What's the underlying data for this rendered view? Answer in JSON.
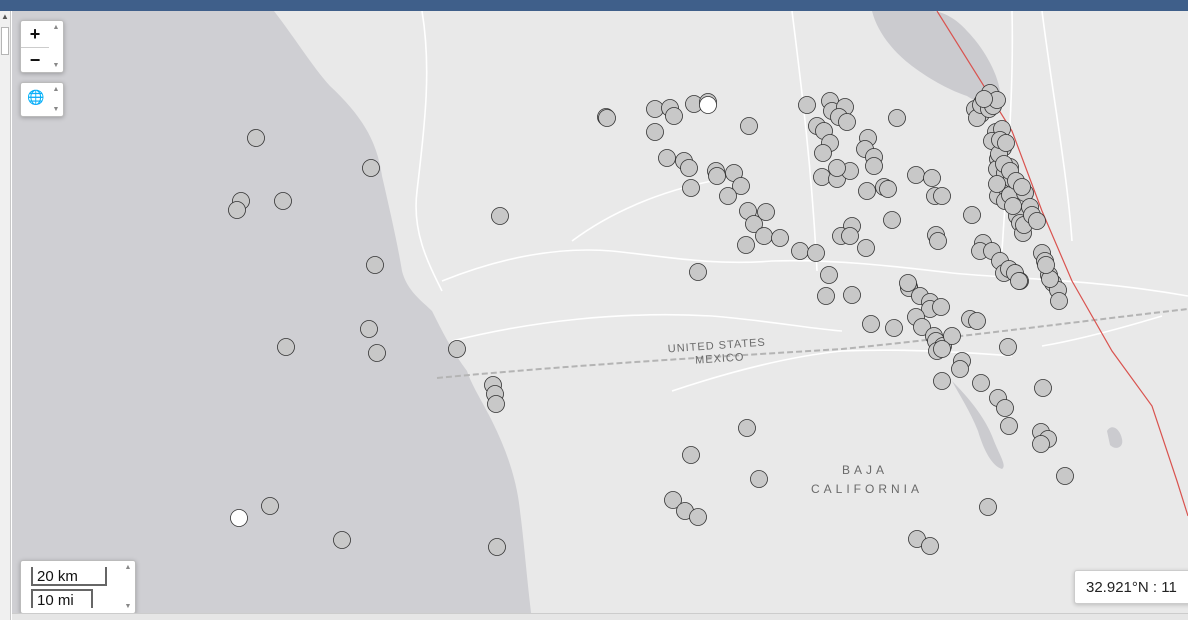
{
  "map": {
    "zoom_in_label": "+",
    "zoom_out_label": "−",
    "layers_icon": "globe-icon",
    "border_label_us": "UNITED STATES",
    "border_label_mx": "MEXICO",
    "region_label_line1": "BAJA",
    "region_label_line2": "CALIFORNIA",
    "scale_km": "20 km",
    "scale_mi": "10 mi",
    "coordinate_readout": "32.921°N : 11"
  },
  "colors": {
    "ocean": "#cfcfd3",
    "land": "#e9e9e9",
    "lake": "#cbcbcf",
    "road": "#ffffff",
    "border": "#b4b4b4",
    "fault": "#d9534f",
    "marker_fill": "#c8c8c8",
    "marker_highlight": "#ffffff",
    "marker_stroke": "#333333"
  },
  "markers": {
    "highlighted_count": 2
  }
}
